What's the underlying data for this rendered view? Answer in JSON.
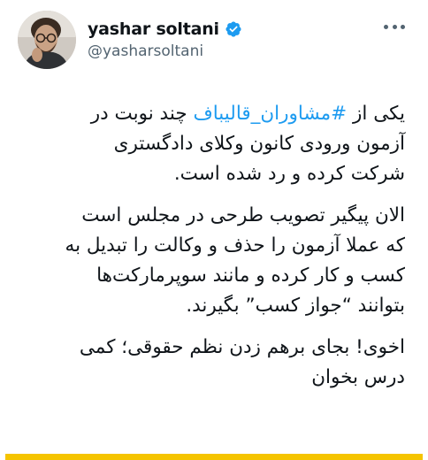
{
  "author": {
    "display_name": "yashar soltani",
    "handle": "@yasharsoltani",
    "verified": true,
    "avatar_icon": "profile-photo",
    "verified_icon": "verified-badge-icon"
  },
  "menu": {
    "icon": "more-options-icon"
  },
  "tweet": {
    "p1": {
      "l1_pre": "یکی از ",
      "l1_hashtag": "#مشاوران_قالیباف",
      "l1_post": " چند نوبت در",
      "l2": "آزمون ورودی کانون وکلای دادگستری",
      "l3": "شرکت کرده و رد شده است."
    },
    "p2": {
      "l1": "الان پیگیر تصویب طرحی در مجلس است",
      "l2": "که عملا آزمون را حذف و وکالت را تبدیل به",
      "l3": "کسب و کار کرده و مانند سوپرمارکت‌ها",
      "l4": "بتوانند “جواز کسب” بگیرند."
    },
    "p3": {
      "l1": "اخوی! بجای برهم زدن نظم حقوقی؛ کمی",
      "l2": "درس بخوان"
    }
  },
  "colors": {
    "text": "#0f1419",
    "secondary": "#536471",
    "link": "#1d9bf0",
    "verified": "#1d9bf0",
    "bottom_bar": "#f5c400"
  }
}
